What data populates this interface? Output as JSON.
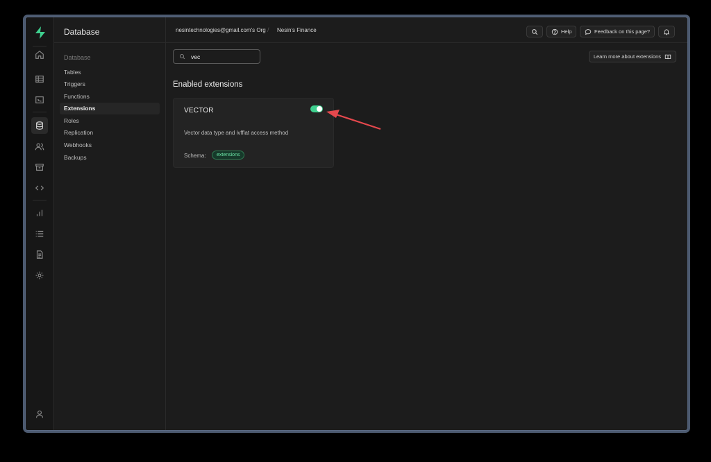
{
  "sidebar": {
    "title": "Database",
    "section": "Database",
    "items": [
      {
        "label": "Tables"
      },
      {
        "label": "Triggers"
      },
      {
        "label": "Functions"
      },
      {
        "label": "Extensions",
        "active": true
      },
      {
        "label": "Roles"
      },
      {
        "label": "Replication"
      },
      {
        "label": "Webhooks"
      },
      {
        "label": "Backups"
      }
    ]
  },
  "topbar": {
    "org": "nesintechnologies@gmail.com's Org",
    "separator": "/",
    "project": "Nesin's Finance",
    "help_label": "Help",
    "feedback_label": "Feedback on this page?"
  },
  "main": {
    "search": {
      "value": "vec",
      "placeholder": ""
    },
    "learn_more_label": "Learn more about extensions",
    "heading": "Enabled extensions",
    "extension": {
      "name": "VECTOR",
      "enabled": true,
      "description": "Vector data type and ivfflat access method",
      "schema_label": "Schema:",
      "schema_value": "extensions"
    }
  },
  "rail_icons": [
    "home-icon",
    "table-editor-icon",
    "sql-editor-icon",
    "database-icon",
    "auth-users-icon",
    "storage-icon",
    "edge-functions-icon",
    "reports-icon",
    "logs-icon",
    "api-docs-icon",
    "settings-icon",
    "user-icon"
  ],
  "colors": {
    "accent": "#3ecf8e",
    "annotation_arrow": "#e5484d",
    "background": "#1c1c1c"
  }
}
